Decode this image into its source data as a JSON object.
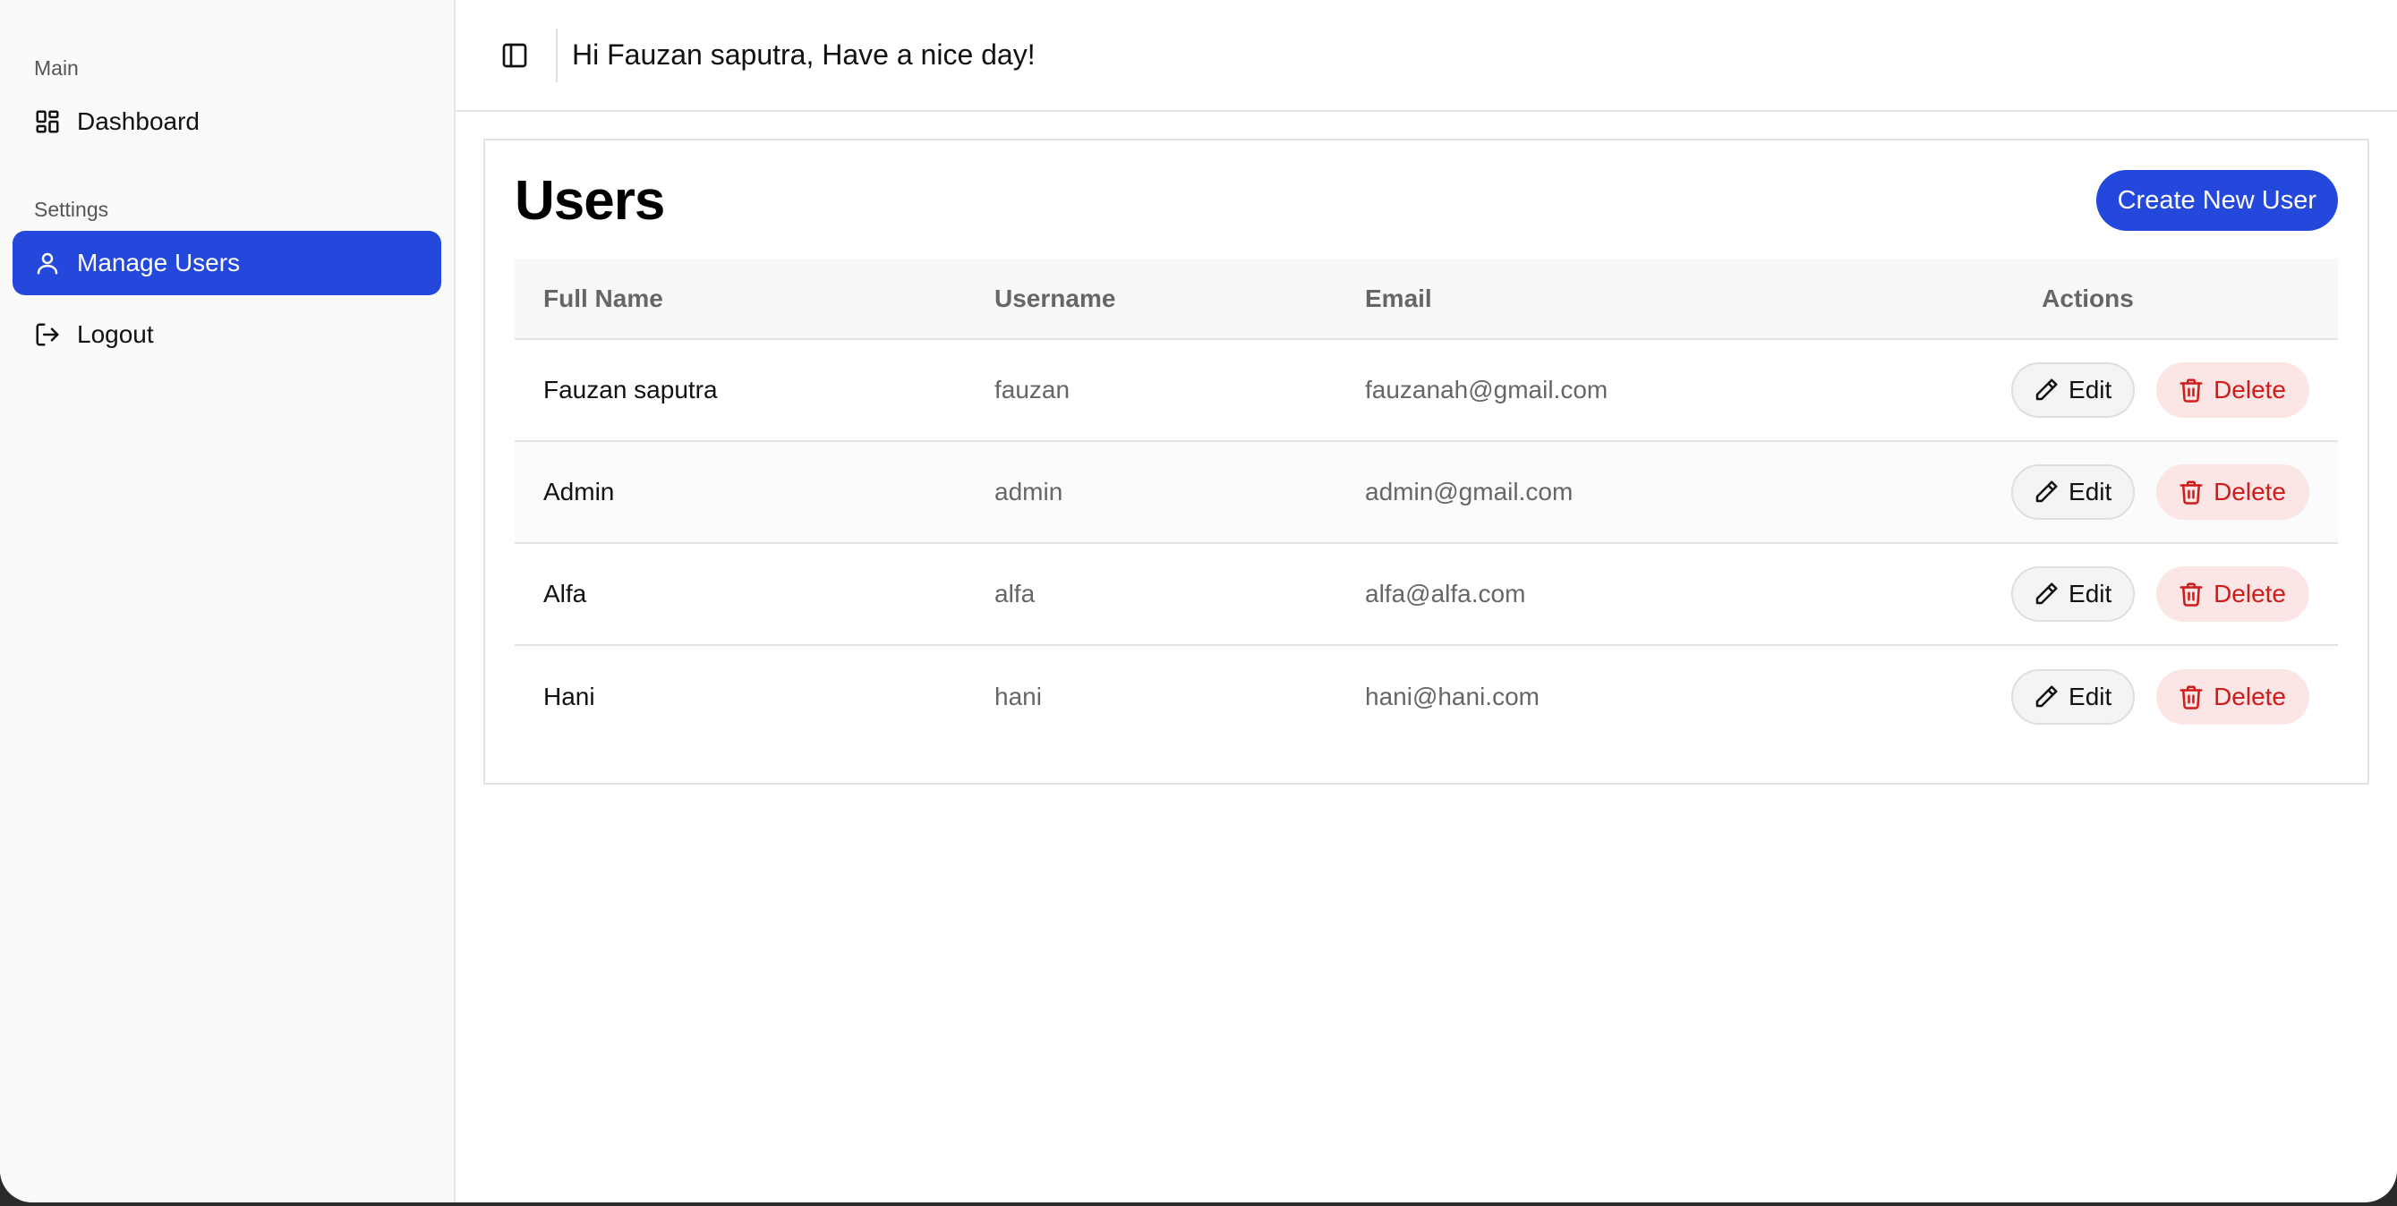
{
  "sidebar": {
    "groups": [
      {
        "label": "Main",
        "items": [
          {
            "label": "Dashboard",
            "icon": "dashboard-icon"
          }
        ]
      },
      {
        "label": "Settings",
        "items": [
          {
            "label": "Manage Users",
            "icon": "user-icon",
            "active": true
          },
          {
            "label": "Logout",
            "icon": "logout-icon"
          }
        ]
      }
    ]
  },
  "header": {
    "greeting": "Hi Fauzan saputra, Have a nice day!"
  },
  "page": {
    "title": "Users",
    "create_label": "Create New User"
  },
  "table": {
    "columns": [
      "Full Name",
      "Username",
      "Email",
      "Actions"
    ],
    "rows": [
      {
        "full_name": "Fauzan saputra",
        "username": "fauzan",
        "email": "fauzanah@gmail.com"
      },
      {
        "full_name": "Admin",
        "username": "admin",
        "email": "admin@gmail.com"
      },
      {
        "full_name": "Alfa",
        "username": "alfa",
        "email": "alfa@alfa.com"
      },
      {
        "full_name": "Hani",
        "username": "hani",
        "email": "hani@hani.com"
      }
    ],
    "edit_label": "Edit",
    "delete_label": "Delete"
  },
  "colors": {
    "accent": "#2447dc",
    "danger": "#d11a1a",
    "danger_bg": "#fbe5e5"
  }
}
